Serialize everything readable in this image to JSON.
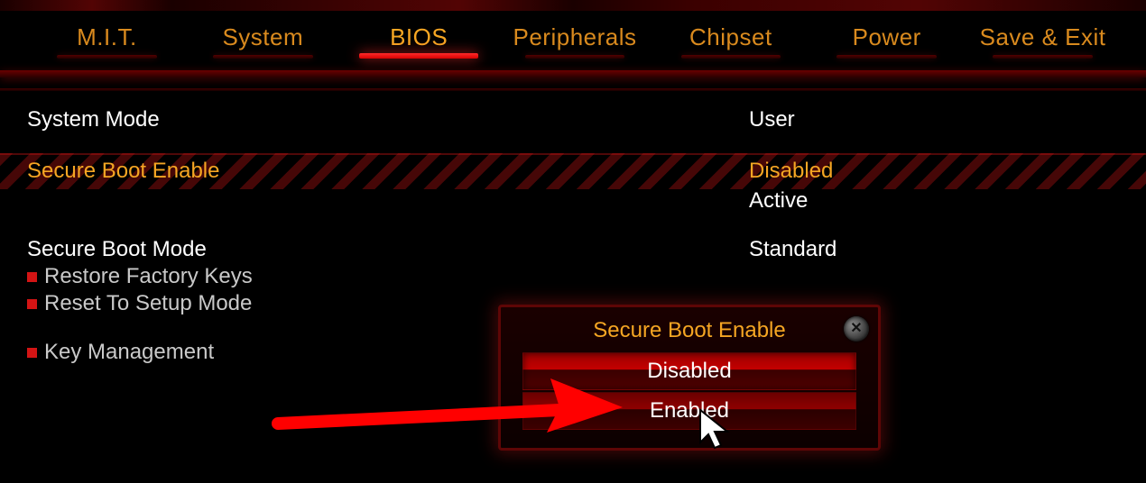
{
  "tabs": [
    {
      "label": "M.I.T."
    },
    {
      "label": "System"
    },
    {
      "label": "BIOS"
    },
    {
      "label": "Peripherals"
    },
    {
      "label": "Chipset"
    },
    {
      "label": "Power"
    },
    {
      "label": "Save & Exit"
    }
  ],
  "active_tab_index": 2,
  "settings": {
    "system_mode": {
      "label": "System Mode",
      "value": "User"
    },
    "secure_boot": {
      "label": "Secure Boot Enable",
      "value": "Disabled"
    },
    "secure_boot_state": {
      "value": "Active"
    },
    "secure_boot_mode": {
      "label": "Secure Boot Mode",
      "value": "Standard"
    },
    "restore_keys": {
      "label": "Restore Factory Keys"
    },
    "reset_setup": {
      "label": "Reset To Setup Mode"
    },
    "key_mgmt": {
      "label": "Key Management"
    }
  },
  "popup": {
    "title": "Secure Boot Enable",
    "options": [
      {
        "label": "Disabled"
      },
      {
        "label": "Enabled"
      }
    ],
    "selected_index": 0
  }
}
